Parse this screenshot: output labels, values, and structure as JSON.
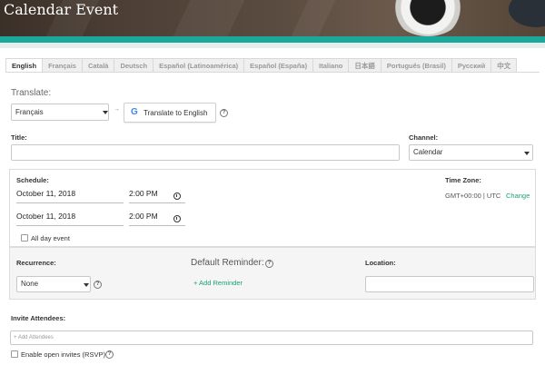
{
  "header": {
    "title": "Calendar Event"
  },
  "tabs": [
    {
      "label": "English",
      "active": true
    },
    {
      "label": "Français"
    },
    {
      "label": "Català"
    },
    {
      "label": "Deutsch"
    },
    {
      "label": "Español (Latinoamérica)"
    },
    {
      "label": "Español (España)"
    },
    {
      "label": "Italiano"
    },
    {
      "label": "日本語"
    },
    {
      "label": "Português (Brasil)"
    },
    {
      "label": "Русский"
    },
    {
      "label": "中文"
    }
  ],
  "translate": {
    "label": "Translate:",
    "source_language": "Français",
    "button_label": "Translate to English",
    "google_glyph": "G"
  },
  "title_field": {
    "label": "Title:",
    "value": ""
  },
  "channel": {
    "label": "Channel:",
    "value": "Calendar"
  },
  "schedule": {
    "label": "Schedule:",
    "start_date": "October 11, 2018",
    "start_time": "2:00 PM",
    "end_date": "October 11, 2018",
    "end_time": "2:00 PM",
    "all_day_label": "All day event",
    "all_day_checked": false,
    "timezone_label": "Time Zone:",
    "timezone_value": "GMT+00:00  |  UTC",
    "timezone_change": "Change"
  },
  "recurrence": {
    "label": "Recurrence:",
    "value": "None"
  },
  "reminder": {
    "label": "Default Reminder:",
    "add_label": "+ Add Reminder"
  },
  "location": {
    "label": "Location:",
    "value": ""
  },
  "attendees": {
    "label": "Invite Attendees:",
    "placeholder": "+ Add Attendees",
    "open_invites_label": "Enable open invites (RSVP)",
    "open_invites_checked": false
  },
  "colors": {
    "accent": "#1aa99a",
    "link_green": "#1aa36e"
  }
}
